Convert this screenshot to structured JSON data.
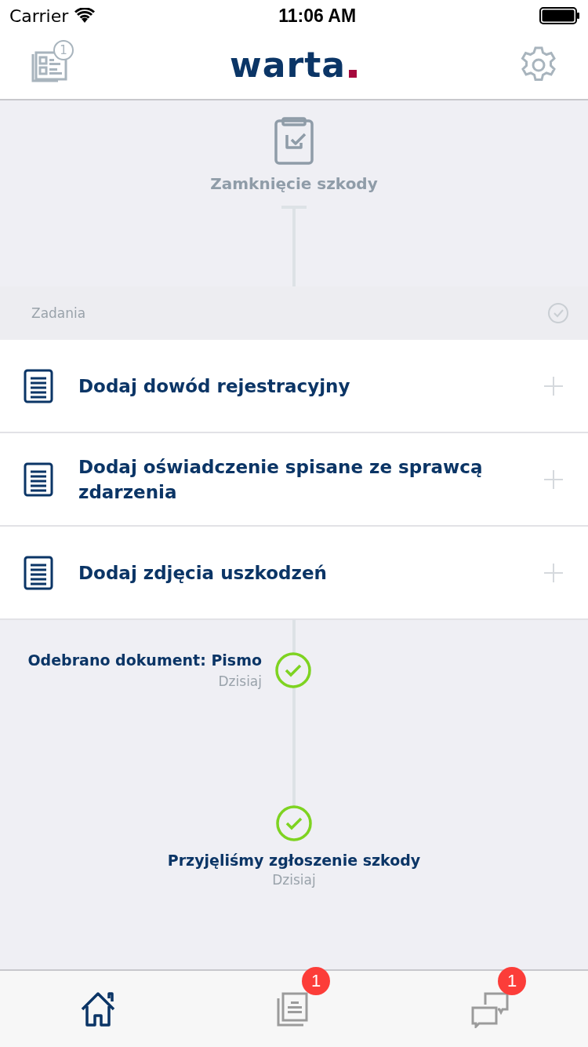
{
  "status_bar": {
    "carrier": "Carrier",
    "time": "11:06 AM"
  },
  "header": {
    "logo": "warta",
    "left_badge": "1"
  },
  "stage": {
    "title": "Zamknięcie szkody"
  },
  "tasks_section": {
    "title": "Zadania",
    "tasks": [
      {
        "label": "Dodaj dowód rejestracyjny"
      },
      {
        "label": "Dodaj oświadczenie spisane ze sprawcą zdarzenia"
      },
      {
        "label": "Dodaj zdjęcia uszkodzeń"
      }
    ]
  },
  "timeline": [
    {
      "kind": "side",
      "title": "Odebrano dokument: Pismo",
      "date": "Dzisiaj",
      "done": true
    },
    {
      "kind": "center",
      "title": "Przyjęliśmy zgłoszenie szkody",
      "date": "Dzisiaj",
      "done": true
    }
  ],
  "tab_bar": [
    {
      "kind": "home",
      "selected": true
    },
    {
      "kind": "documents",
      "selected": false,
      "badge": "1"
    },
    {
      "kind": "messages",
      "selected": false,
      "badge": "1"
    }
  ]
}
